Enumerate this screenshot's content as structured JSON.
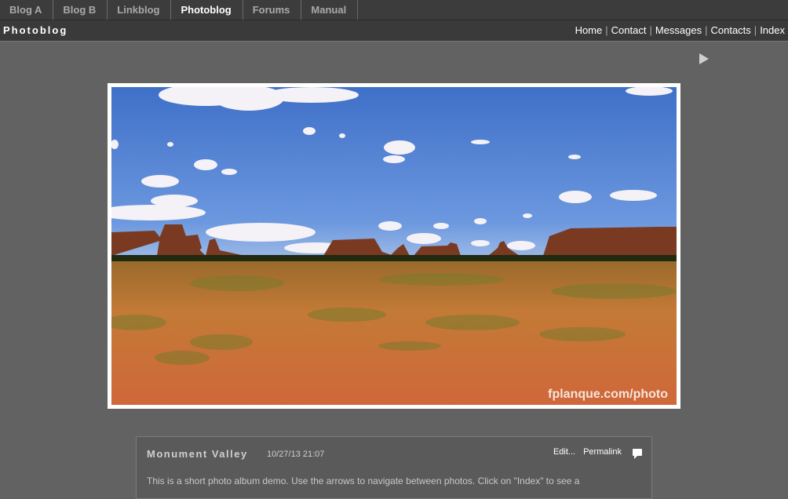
{
  "tabs": [
    {
      "label": "Blog A",
      "active": false
    },
    {
      "label": "Blog B",
      "active": false
    },
    {
      "label": "Linkblog",
      "active": false
    },
    {
      "label": "Photoblog",
      "active": true
    },
    {
      "label": "Forums",
      "active": false
    },
    {
      "label": "Manual",
      "active": false
    }
  ],
  "header": {
    "blog_title": "Photoblog",
    "links": [
      "Home",
      "Contact",
      "Messages",
      "Contacts",
      "Index"
    ],
    "separator": "|"
  },
  "photo": {
    "watermark": "fplanque.com/photo",
    "colors": {
      "sky": "#4a7fd3",
      "ground": "#c8642e",
      "frame": "#ffffff"
    }
  },
  "post": {
    "title": "Monument Valley",
    "date": "10/27/13 21:07",
    "edit_label": "Edit...",
    "permalink_label": "Permalink",
    "body": "This is a short photo album demo. Use the arrows to navigate between photos. Click on \"Index\" to see a"
  },
  "icons": {
    "next": "play-arrow-icon",
    "comment": "comment-icon"
  }
}
